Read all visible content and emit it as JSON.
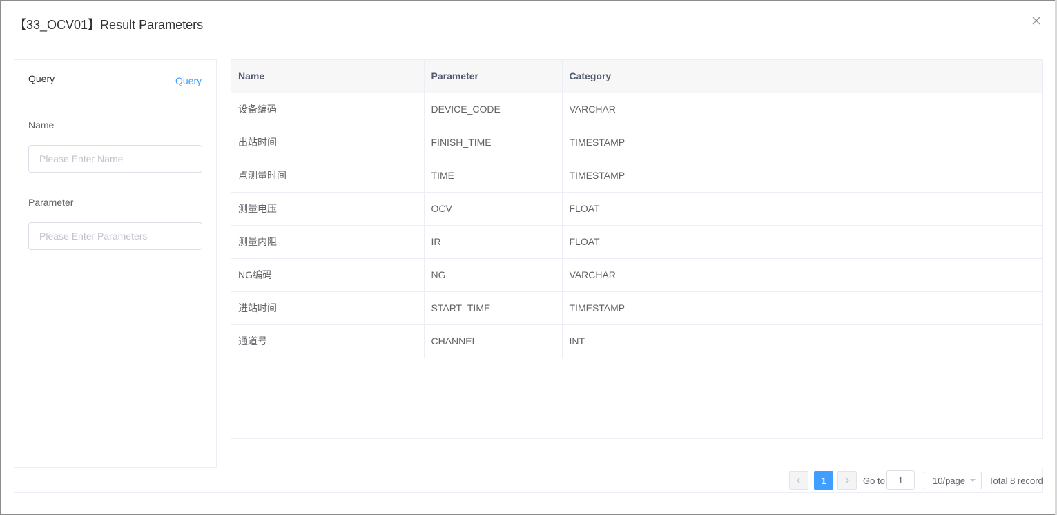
{
  "dialog": {
    "title": "【33_OCV01】Result Parameters",
    "close_icon": "close-icon"
  },
  "query": {
    "title": "Query",
    "query_link": "Query",
    "name_label": "Name",
    "name_placeholder": "Please Enter Name",
    "name_value": "",
    "parameter_label": "Parameter",
    "parameter_placeholder": "Please Enter Parameters",
    "parameter_value": ""
  },
  "table": {
    "columns": [
      "Name",
      "Parameter",
      "Category"
    ],
    "rows": [
      [
        "设备编码",
        "DEVICE_CODE",
        "VARCHAR"
      ],
      [
        "出站时间",
        "FINISH_TIME",
        "TIMESTAMP"
      ],
      [
        "点测量时间",
        "TIME",
        "TIMESTAMP"
      ],
      [
        "测量电压",
        "OCV",
        "FLOAT"
      ],
      [
        "测量内阻",
        "IR",
        "FLOAT"
      ],
      [
        "NG编码",
        "NG",
        "VARCHAR"
      ],
      [
        "进站时间",
        "START_TIME",
        "TIMESTAMP"
      ],
      [
        "通道号",
        "CHANNEL",
        "INT"
      ]
    ]
  },
  "pagination": {
    "prev_icon": "chevron-left-icon",
    "current_page": "1",
    "next_icon": "chevron-right-icon",
    "goto_label": "Go to",
    "goto_value": "1",
    "page_size": "10/page",
    "total": "Total 8 record",
    "accent_color": "#409eff"
  }
}
